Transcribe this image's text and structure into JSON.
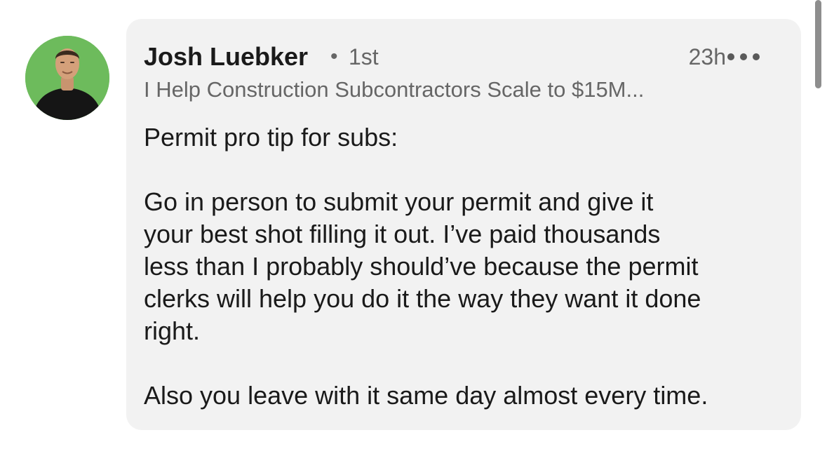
{
  "author": {
    "name": "Josh Luebker",
    "separator": "•",
    "degree": "1st",
    "headline": "I Help Construction Subcontractors Scale to $15M..."
  },
  "comment": {
    "timestamp": "23h",
    "more_icon": "more-horizontal-icon",
    "lines": {
      "l1": "Permit pro tip for subs:",
      "l2": "Go in person to submit your permit and give it",
      "l3": "your best shot filling it out. I’ve paid thousands",
      "l4": "less than I probably should’ve because the permit",
      "l5": "clerks will help you do it the way they want it done",
      "l6": "right.",
      "l7": "Also you leave with it same day almost every time."
    }
  },
  "colors": {
    "avatar_background": "#6dbb5c",
    "bubble_background": "#f2f2f2",
    "primary_text": "#1a1a1a",
    "secondary_text": "#666666"
  }
}
